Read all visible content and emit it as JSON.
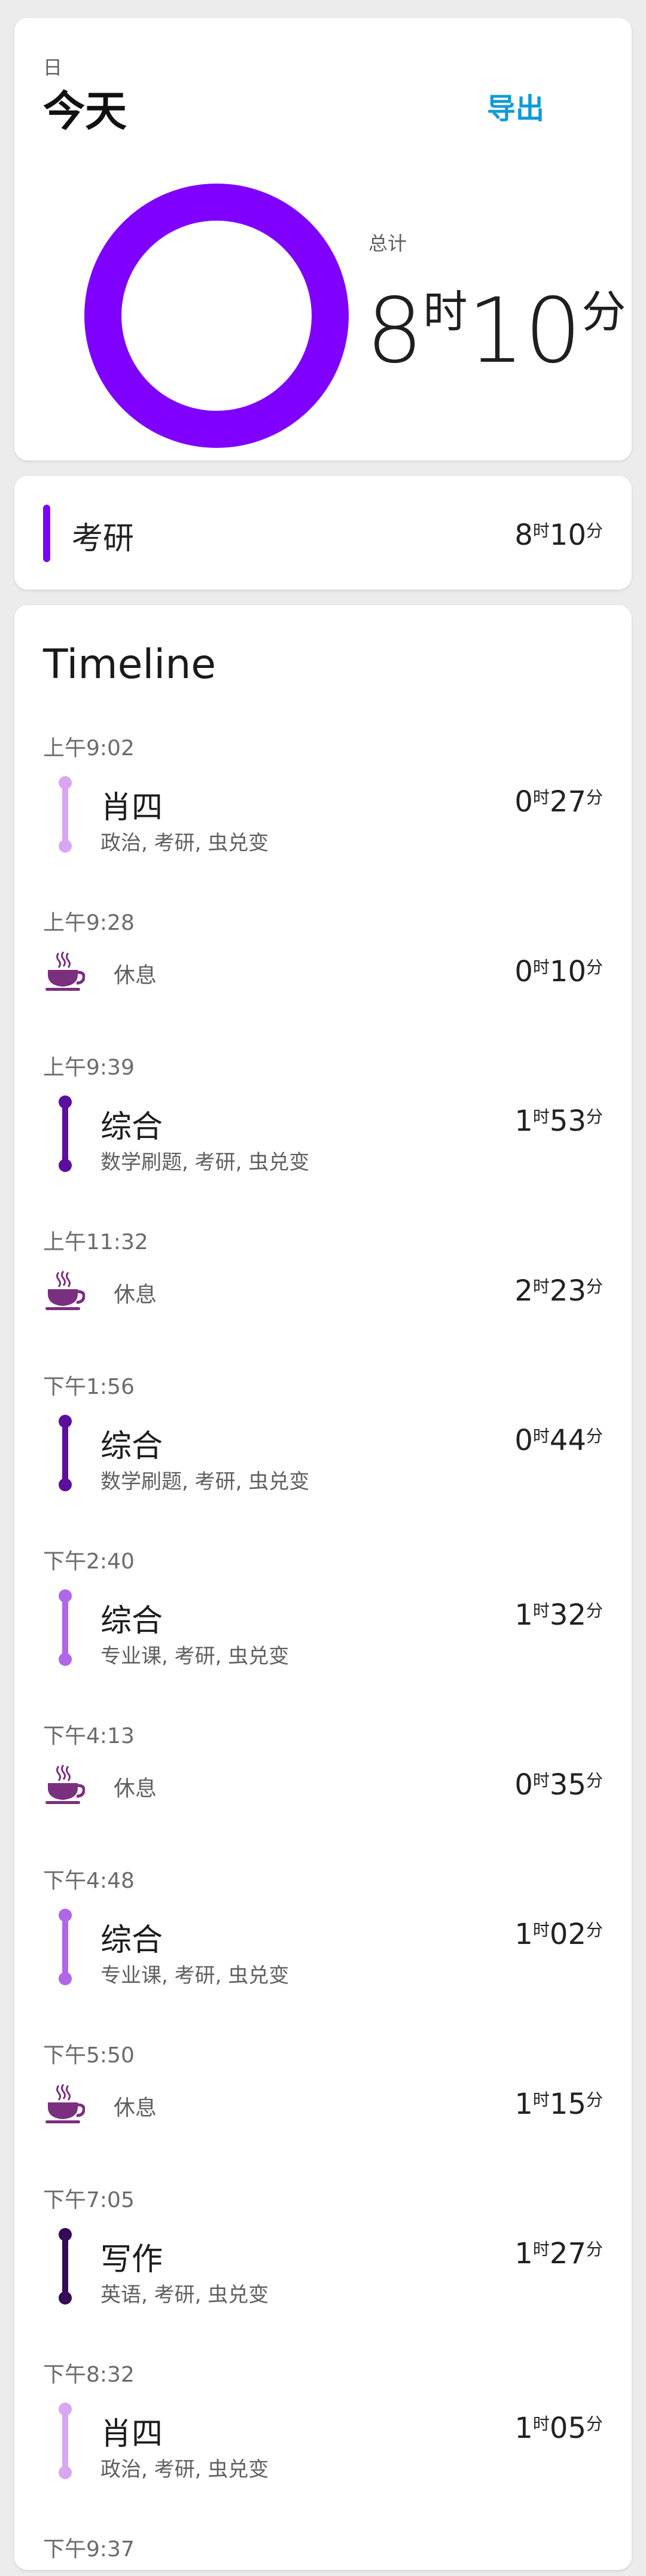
{
  "summary": {
    "period_label": "日",
    "period_title": "今天",
    "export_label": "导出",
    "total_label": "总计",
    "total": {
      "hours": "8",
      "hour_unit": "时",
      "minutes": "10",
      "minute_unit": "分"
    },
    "ring_color": "#7f00ff"
  },
  "category": {
    "name": "考研",
    "color": "#7f00ff",
    "duration": {
      "hours": "8",
      "hour_unit": "时",
      "minutes": "10",
      "minute_unit": "分"
    }
  },
  "timeline": {
    "title": "Timeline",
    "events": [
      {
        "time": "上午9:02",
        "kind": "task",
        "title": "肖四",
        "tags": "政治, 考研, 虫兑变",
        "color": "#d9a6f2",
        "hours": "0",
        "minutes": "27"
      },
      {
        "time": "上午9:28",
        "kind": "break",
        "title": "休息",
        "color": "#7a2f7f",
        "hours": "0",
        "minutes": "10"
      },
      {
        "time": "上午9:39",
        "kind": "task",
        "title": "综合",
        "tags": "数学刷题, 考研, 虫兑变",
        "color": "#5c0f9e",
        "hours": "1",
        "minutes": "53"
      },
      {
        "time": "上午11:32",
        "kind": "break",
        "title": "休息",
        "color": "#7a2f7f",
        "hours": "2",
        "minutes": "23"
      },
      {
        "time": "下午1:56",
        "kind": "task",
        "title": "综合",
        "tags": "数学刷题, 考研, 虫兑变",
        "color": "#5c0f9e",
        "hours": "0",
        "minutes": "44"
      },
      {
        "time": "下午2:40",
        "kind": "task",
        "title": "综合",
        "tags": "专业课, 考研, 虫兑变",
        "color": "#b066e8",
        "hours": "1",
        "minutes": "32"
      },
      {
        "time": "下午4:13",
        "kind": "break",
        "title": "休息",
        "color": "#7a2f7f",
        "hours": "0",
        "minutes": "35"
      },
      {
        "time": "下午4:48",
        "kind": "task",
        "title": "综合",
        "tags": "专业课, 考研, 虫兑变",
        "color": "#b066e8",
        "hours": "1",
        "minutes": "02"
      },
      {
        "time": "下午5:50",
        "kind": "break",
        "title": "休息",
        "color": "#7a2f7f",
        "hours": "1",
        "minutes": "15"
      },
      {
        "time": "下午7:05",
        "kind": "task",
        "title": "写作",
        "tags": "英语, 考研, 虫兑变",
        "color": "#350a57",
        "hours": "1",
        "minutes": "27"
      },
      {
        "time": "下午8:32",
        "kind": "task",
        "title": "肖四",
        "tags": "政治, 考研, 虫兑变",
        "color": "#d9a6f2",
        "hours": "1",
        "minutes": "05"
      }
    ],
    "end_time": "下午9:37",
    "hour_unit": "时",
    "minute_unit": "分"
  }
}
